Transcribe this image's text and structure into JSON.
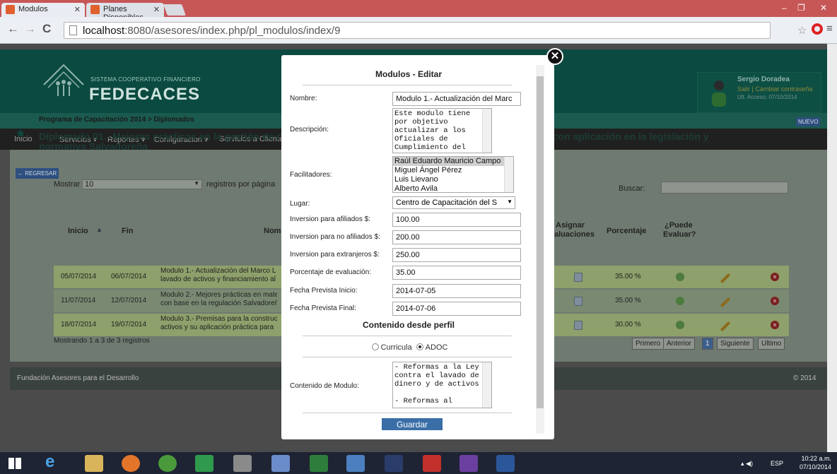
{
  "browser": {
    "tabs": [
      {
        "label": "Modulos"
      },
      {
        "label": "Planes Disponibles"
      }
    ],
    "url_host": "localhost",
    "url_path": ":8080/asesores/index.php/pl_modulos/index/9"
  },
  "header": {
    "brand_small": "SISTEMA COOPERATIVO FINANCIERO",
    "brand_name": "FEDECACES",
    "user_name": "Sergio Doradea",
    "user_links": "Salir | Cambiar contraseña",
    "user_last_access": "Ult. Acceso: 07/10/2014"
  },
  "nav": {
    "items": [
      "Inicio",
      "Servicios ▾",
      "Reportes ▾",
      "Configuracion ▾",
      "Servicios a Clientes"
    ]
  },
  "content": {
    "breadcrumb": "Programa de Capacitación 2014 > Diplomados",
    "title": "Diplomado 01.- Mejores prácticas en la gestión de riesgo de lavado de activos y financiamiento al terrorismo con aplicación en la legislación y normativa Salvadoreña",
    "nuevo_label": "NUEVO",
    "regresar_label": "← REGRESAR",
    "mostrar_label": "Mostrar",
    "mostrar_value": "10",
    "mostrar_suffix": "registros por página",
    "buscar_label": "Buscar:",
    "columns": {
      "inicio": "Inicio",
      "fin": "Fin",
      "nombre": "Nom",
      "asignar": "Asignar",
      "asignar2": "aluaciones",
      "porcentaje": "Porcentaje",
      "puede": "¿Puede",
      "puede2": "Evaluar?"
    },
    "rows": [
      {
        "inicio": "05/07/2014",
        "fin": "06/07/2014",
        "nombre1": "Modulo 1.- Actualización del Marco L",
        "nombre2": "lavado de activos y financiamiento al",
        "porcentaje": "35.00 %"
      },
      {
        "inicio": "11/07/2014",
        "fin": "12/07/2014",
        "nombre1": "Modulo 2.- Mejores prácticas en mate",
        "nombre2": "con base en la regulación Salvadoreñ",
        "porcentaje": "35.00 %"
      },
      {
        "inicio": "18/07/2014",
        "fin": "19/07/2014",
        "nombre1": "Modulo 3.- Premisas para la construc",
        "nombre2": "activos y su aplicación práctica para",
        "porcentaje": "30.00 %"
      }
    ],
    "showing": "Mostrando 1 a 3 de 3 registros",
    "pagination": [
      "Primero",
      "Anterior",
      "1",
      "Siguiente",
      "Ultimo"
    ]
  },
  "footer": {
    "left": "Fundación Asesores para el Desarrollo",
    "right": "© 2014"
  },
  "modal": {
    "title": "Modulos - Editar",
    "nombre_label": "Nombre:",
    "nombre_value": "Modulo 1.- Actualización del Marc",
    "descripcion_label": "Descripción:",
    "descripcion_value": "Este modulo tiene\npor objetivo\nactualizar a los\nOficiales de\nCumplimiento del",
    "facilitadores_label": "Facilitadores:",
    "facilitadores": [
      "Raúl Eduardo Mauricio Campo",
      "Miguel Ángel Pérez",
      "Luis Lievano",
      "Alberto Avila"
    ],
    "lugar_label": "Lugar:",
    "lugar_value": "Centro de Capacitación del S",
    "inv_afil_label": "Inversion para afiliados $:",
    "inv_afil_value": "100.00",
    "inv_noafil_label": "Inversion para no afiliados $:",
    "inv_noafil_value": "200.00",
    "inv_ext_label": "Inversion para extranjeros $:",
    "inv_ext_value": "250.00",
    "porc_label": "Porcentaje de evaluación:",
    "porc_value": "35.00",
    "fini_label": "Fecha Prevista Inicio:",
    "fini_value": "2014-07-05",
    "ffin_label": "Fecha Prevista Final:",
    "ffin_value": "2014-07-06",
    "contenido_title": "Contenido desde perfil",
    "radio1": "Curricula",
    "radio2": "ADOC",
    "contenido_label": "Contenido de Modulo:",
    "contenido_value": "- Reformas a la Ley\ncontra el lavado de\ndinero y de activos\n\n- Reformas al",
    "guardar_label": "Guardar"
  },
  "taskbar": {
    "lang": "ESP",
    "time": "10:22 a.m.",
    "date": "07/10/2014"
  }
}
